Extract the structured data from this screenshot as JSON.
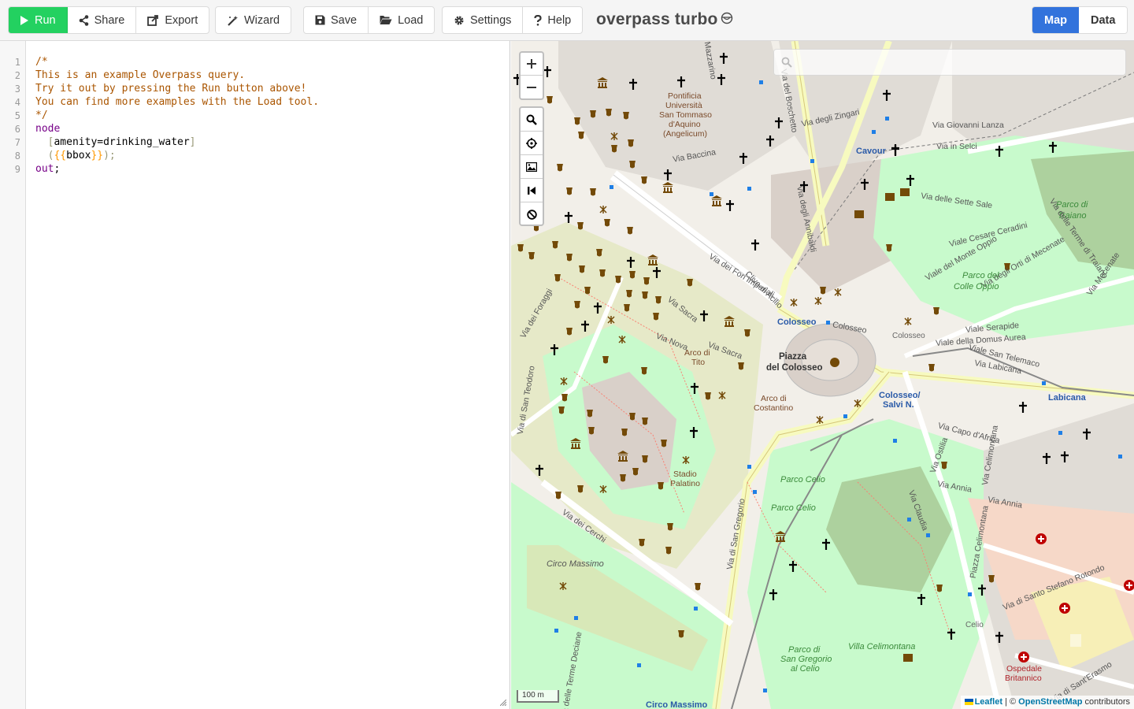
{
  "toolbar": {
    "run_label": "Run",
    "share_label": "Share",
    "export_label": "Export",
    "wizard_label": "Wizard",
    "save_label": "Save",
    "load_label": "Load",
    "settings_label": "Settings",
    "help_label": "Help"
  },
  "app": {
    "title": "overpass turbo"
  },
  "view_tabs": {
    "map_label": "Map",
    "data_label": "Data",
    "active": "Map"
  },
  "editor": {
    "line_numbers": [
      "1",
      "2",
      "3",
      "4",
      "5",
      "6",
      "7",
      "8",
      "9"
    ],
    "lines": {
      "l1": "/*",
      "l2": "This is an example Overpass query.",
      "l3": "Try it out by pressing the Run button above!",
      "l4": "You can find more examples with the Load tool.",
      "l5": "*/",
      "l6": "node",
      "l7_open": "[",
      "l7_body": "amenity=drinking_water",
      "l7_close": "]",
      "l8_open": "(",
      "l8_tpl_open": "{{",
      "l8_body": "bbox",
      "l8_tpl_close": "}}",
      "l8_close": ");",
      "l9_kw": "out",
      "l9_rest": ";"
    }
  },
  "map": {
    "scale_label": "100 m",
    "attribution": {
      "leaflet": "Leaflet",
      "sep": " | © ",
      "osm": "OpenStreetMap",
      "suffix": " contributors"
    },
    "labels": {
      "colosseo": "Colosseo",
      "colosseo_road": "Colosseo",
      "colosseo2": "Colosseo",
      "piazza1": "Piazza",
      "piazza2": "del Colosseo",
      "cavour": "Cavour",
      "via_giovanni_lanza": "Via Giovanni Lanza",
      "via_in_selci": "Via in Selci",
      "via_degli_zingari": "Via degli Zingari",
      "via_baccina": "Via Baccina",
      "via_degli_annibaldi": "Via degli Annibaldi",
      "via_delle_sette_sale": "Via delle Sette Sale",
      "parco_traiano1": "Parco di",
      "parco_traiano2": "Traiano",
      "viale_cesare": "Viale Cesare Ceradini",
      "viale_monte_oppio": "Viale del Monte Oppio",
      "via_orti": "Via degli Orti di Mecenate",
      "parco_colle1": "Parco del",
      "parco_colle2": "Colle Oppio",
      "viale_serapide": "Viale Serapide",
      "viale_domus": "Viale della Domus Aurea",
      "via_san_telemaco": "Viale San Telemaco",
      "via_labicana": "Via Labicana",
      "labicana": "Labicana",
      "colosseo_salvi1": "Colosseo/",
      "colosseo_salvi2": "Salvi N.",
      "via_capo": "Via Capo d'Africa",
      "via_ostilia": "Via Ostilia",
      "via_annia": "Via Annia",
      "via_annia2": "Via Annia",
      "via_claudia": "Via Claudia",
      "via_celimontana": "Via Celimontana",
      "piazza_celimontana": "Piazza Celimontana",
      "parco_celio": "Parco Celio",
      "parco_celio2": "Parco Celio",
      "via_san_gregorio": "Via di San Gregorio",
      "villa_celimontana": "Villa Celimontana",
      "parco_sg1": "Parco di",
      "parco_sg2": "San Gregorio",
      "parco_sg3": "al Celio",
      "ospedale1": "Ospedale",
      "ospedale2": "Britannico",
      "via_santo_stefano": "Via di Santo Stefano Rotondo",
      "via_san_erasmo": "Via di Sant'Erasmo",
      "celio": "Celio",
      "circo_massimo": "Circo Massimo",
      "circo_massimo_stop": "Circo Massimo",
      "via_dei_cerchi": "Via dei Cerchi",
      "stadio1": "Stadio",
      "stadio2": "Palatino",
      "arco_tito1": "Arco di",
      "arco_tito2": "Tito",
      "arco_cost1": "Arco di",
      "arco_cost2": "Costantino",
      "via_sacra": "Via Sacra",
      "via_sacra2": "Via Sacra",
      "via_nova": "Via Nova",
      "via_fori": "Via dei Fori Imperiali",
      "clivo": "Clivo di Acilio",
      "via_foraggi": "Via dei Foraggi",
      "via_san_teodoro": "Via di San Teodoro",
      "univ1": "Pontificia",
      "univ2": "Università",
      "univ3": "San Tommaso",
      "univ4": "d'Aquino",
      "univ5": "(Angelicum)",
      "via_boschetto": "Via del Boschetto",
      "via_mazzarino": "Via Mazzarino",
      "via_terme_deciane": "Via delle Terme Deciane",
      "via_mecenate": "Via Mecenate",
      "via_terme_traiano": "Via delle Terme di Traiano"
    }
  },
  "colors": {
    "run_green": "#23d160",
    "map_blue": "#3273dc",
    "park_green": "#c8facc",
    "road_yellow": "#f7fabf",
    "poi_brown": "#734a08"
  }
}
